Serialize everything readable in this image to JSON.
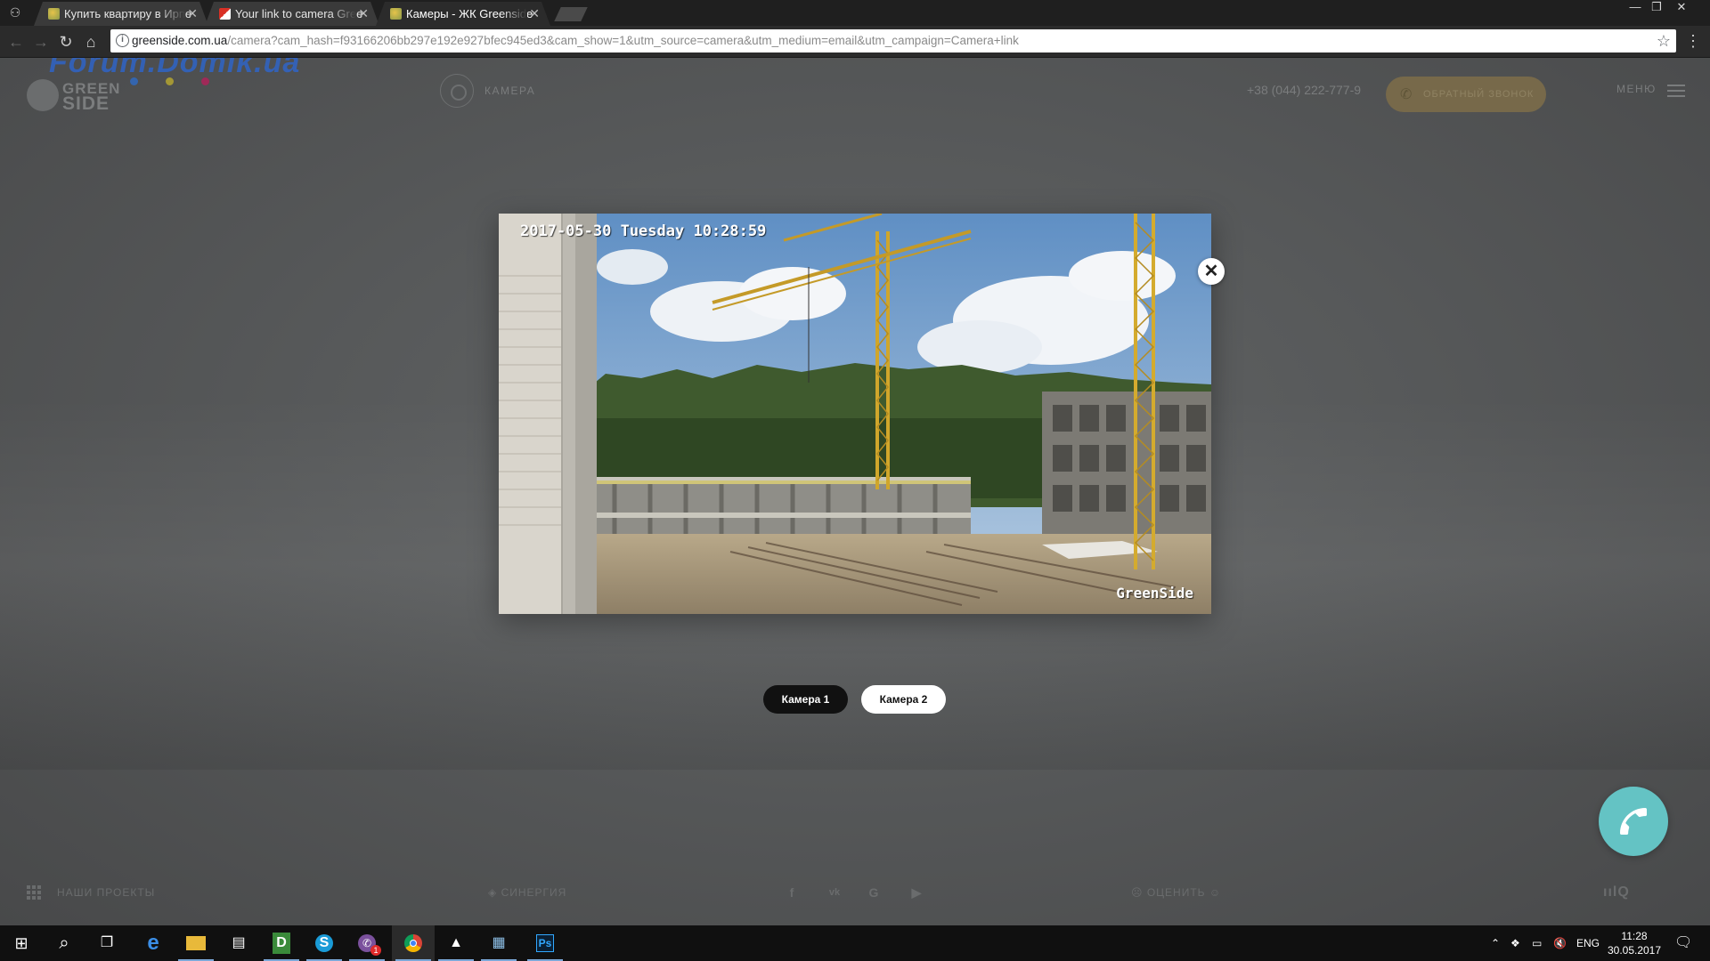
{
  "browser": {
    "tabs": [
      {
        "title": "Купить квартиру в Ирпе",
        "favicon": "greenside-favicon",
        "active": false
      },
      {
        "title": "Your link to camera Gree",
        "favicon": "gmail-favicon",
        "active": false
      },
      {
        "title": "Камеры - ЖК Greenside",
        "favicon": "greenside-favicon",
        "active": true
      }
    ],
    "close_glyph": "✕",
    "url_host": "greenside.com.ua",
    "url_rest": "/camera?cam_hash=f93166206bb297e192e927bfec945ed3&cam_show=1&utm_source=camera&utm_medium=email&utm_campaign=Camera+link",
    "window_controls": [
      "—",
      "❐",
      "✕"
    ]
  },
  "site": {
    "watermark": "Forum.Domik.ua",
    "logo_line1": "GREEN",
    "logo_line2": "SIDE",
    "camera_nav_label": "КАМЕРА",
    "phone": "+38 (044) 222-777-9",
    "callback_label": "ОБРАТНЫЙ ЗВОНОК",
    "menu_label": "МЕНЮ",
    "footer_projects": "НАШИ ПРОЕКТЫ",
    "footer_partner": "СИНЕРГИЯ",
    "footer_rate": "ОЦЕНИТЬ",
    "footer_social": [
      "f",
      "vk",
      "G",
      "▶"
    ],
    "dot_colors": [
      "#2a6fd6",
      "#c9b62a",
      "#c2185b"
    ]
  },
  "camera_modal": {
    "timestamp": "2017-05-30 Tuesday 10:28:59",
    "overlay_brand": "GreenSide",
    "close_glyph": "✕",
    "tabs": [
      {
        "label": "Камера 1",
        "active": true
      },
      {
        "label": "Камера 2",
        "active": false
      }
    ]
  },
  "taskbar": {
    "apps": [
      {
        "icon": "windows-start-icon",
        "glyph": "⊞"
      },
      {
        "icon": "search-icon",
        "glyph": "⌕"
      },
      {
        "icon": "task-view-icon",
        "glyph": "❐"
      },
      {
        "icon": "edge-icon",
        "glyph": "e"
      },
      {
        "icon": "file-explorer-icon",
        "glyph": "▭"
      },
      {
        "icon": "store-icon",
        "glyph": "▤"
      },
      {
        "icon": "dashlane-icon",
        "glyph": "D"
      },
      {
        "icon": "skype-icon",
        "glyph": "S"
      },
      {
        "icon": "viber-icon",
        "glyph": "✆"
      },
      {
        "icon": "chrome-icon",
        "glyph": "◉"
      },
      {
        "icon": "photos-icon",
        "glyph": "▲"
      },
      {
        "icon": "image-viewer-icon",
        "glyph": "▦"
      },
      {
        "icon": "photoshop-icon",
        "glyph": "Ps"
      }
    ],
    "viber_badge": "1",
    "language": "ENG",
    "time": "11:28",
    "date": "30.05.2017"
  }
}
